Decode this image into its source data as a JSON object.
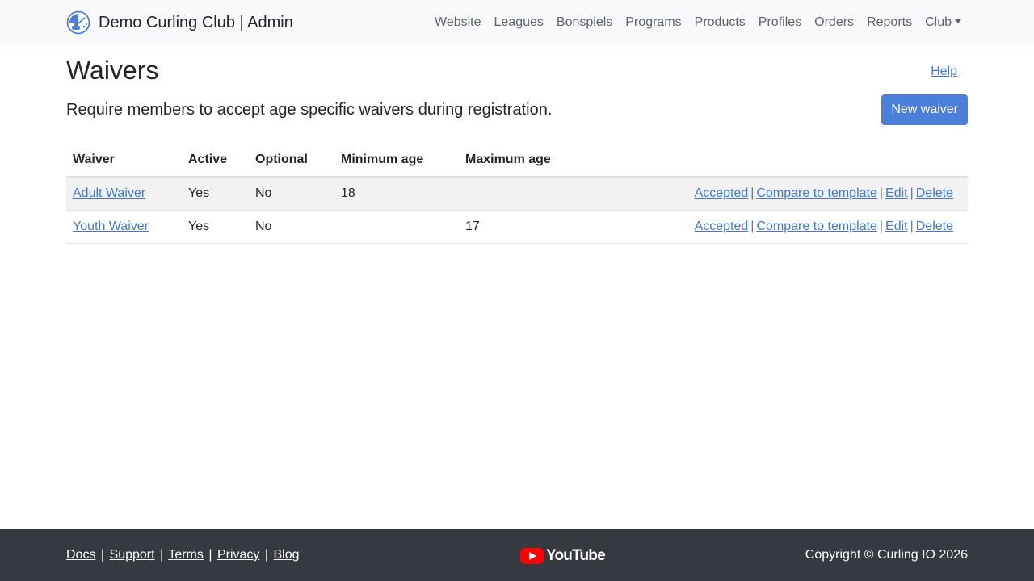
{
  "navbar": {
    "brand": "Demo Curling Club | Admin",
    "items": [
      "Website",
      "Leagues",
      "Bonspiels",
      "Programs",
      "Products",
      "Profiles",
      "Orders",
      "Reports"
    ],
    "club_label": "Club"
  },
  "page": {
    "title": "Waivers",
    "help_label": "Help",
    "lead": "Require members to accept age specific waivers during registration.",
    "new_button": "New waiver"
  },
  "table": {
    "headers": [
      "Waiver",
      "Active",
      "Optional",
      "Minimum age",
      "Maximum age"
    ],
    "rows": [
      {
        "name": "Adult Waiver",
        "active": "Yes",
        "optional": "No",
        "min_age": "18",
        "max_age": ""
      },
      {
        "name": "Youth Waiver",
        "active": "Yes",
        "optional": "No",
        "min_age": "",
        "max_age": "17"
      }
    ],
    "actions": {
      "accepted": "Accepted",
      "compare": "Compare to template",
      "edit": "Edit",
      "delete": "Delete",
      "separator": "|"
    }
  },
  "footer": {
    "links": [
      "Docs",
      "Support",
      "Terms",
      "Privacy",
      "Blog"
    ],
    "link_separator": "|",
    "video_brand": "YouTube",
    "copyright": "Copyright © Curling IO 2026"
  },
  "colors": {
    "primary": "#4a7fdc",
    "link": "#3f78d8",
    "navbar_bg": "#f8f9fa",
    "footer_bg": "#343a40",
    "youtube_red": "#ff0000"
  }
}
